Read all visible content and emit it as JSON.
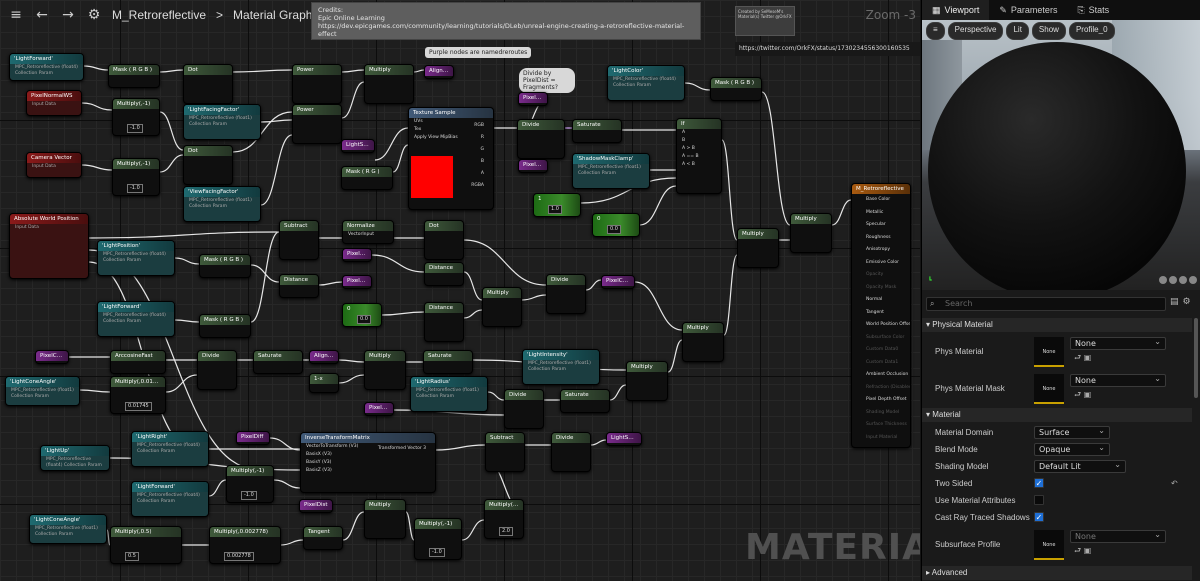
{
  "toolbar": {
    "title": "M_Retroreflective",
    "sep": ">",
    "sub": "Material Graph",
    "zoom": "Zoom -3"
  },
  "comment": {
    "text": "Credits:\nEpic Online Learning\nhttps://dev.epicgames.com/community/learning/tutorials/DLeb/unreal-engine-creating-a-retroreflective-material-effect"
  },
  "notes": {
    "purple": "Purple nodes are namedreroutes",
    "divide_q": "Divide by PixelDist = Fragments?"
  },
  "credit_box": "Created by SeMeseM's Material(s) Twitter @OrkFX",
  "twitter": "https://twitter.com/OrkFX/status/1730234556300160535",
  "watermark": "MATERIAL",
  "nodes": {
    "lightForward1": {
      "title": "'LightForward'",
      "sub": "MPC_Retroreflective (float4) Collection Param"
    },
    "pixelNormal": {
      "title": "PixelNormalWS",
      "sub": "Input Data"
    },
    "cameraVector": {
      "title": "Camera Vector",
      "sub": "Input Data"
    },
    "absWorldPos": {
      "title": "Absolute World Position",
      "sub": "Input Data"
    },
    "maskRGB1": {
      "title": "Mask ( R G B )"
    },
    "mult1": {
      "title": "Multiply(,-1)",
      "val": "-1.0"
    },
    "mult2": {
      "title": "Multiply(,-1)",
      "val": "-1.0"
    },
    "dot1": {
      "title": "Dot"
    },
    "dot2": {
      "title": "Dot"
    },
    "lfFactor": {
      "title": "'LightFacingFactor'",
      "sub": "MPC_Retroreflective (float1) Collection Param"
    },
    "vfFactor": {
      "title": "'ViewFacingFactor'",
      "sub": "MPC_Retroreflective (float1) Collection Param"
    },
    "power1": {
      "title": "Power"
    },
    "power2": {
      "title": "Power"
    },
    "multiplyA": {
      "title": "Multiply"
    },
    "alignDir1": {
      "title": "AlignDir"
    },
    "lightSpace": {
      "title": "LightSpace"
    },
    "maskRG": {
      "title": "Mask ( R G )"
    },
    "texSample": {
      "title": "Texture Sample",
      "pins": [
        "UVs",
        "Tex",
        "Apply View MipBias"
      ],
      "outs": [
        "RGB",
        "R",
        "G",
        "B",
        "A",
        "RGBA"
      ]
    },
    "pixelDist1": {
      "title": "PixelDist"
    },
    "divide1": {
      "title": "Divide"
    },
    "saturate1": {
      "title": "Saturate"
    },
    "pixelDiff1": {
      "title": "PixelDiff"
    },
    "shadowMask": {
      "title": "'ShadowMaskClamp'",
      "sub": "MPC_Retroreflective (float1) Collection Param"
    },
    "lightColor": {
      "title": "'LightColor'",
      "sub": "MPC_Retroreflective (float4) Collection Param"
    },
    "maskRGB2": {
      "title": "Mask ( R G B )"
    },
    "ifNode": {
      "title": "If",
      "pins": [
        "A",
        "B",
        "A > B",
        "A == B",
        "A < B"
      ]
    },
    "const1": {
      "title": "1",
      "val": "1.0"
    },
    "const0": {
      "title": "0",
      "val": "0.0"
    },
    "multRight1": {
      "title": "Multiply"
    },
    "multRight2": {
      "title": "Multiply"
    },
    "multRight3": {
      "title": "Multiply"
    },
    "mResult": {
      "title": "M_Retroreflective",
      "pins": [
        "Base Color",
        "Metallic",
        "Specular",
        "Roughness",
        "Anisotropy",
        "Emissive Color",
        "Opacity",
        "Opacity Mask",
        "Normal",
        "Tangent",
        "World Position Offset",
        "Subsurface Color",
        "Custom Data0",
        "Custom Data1",
        "Ambient Occlusion",
        "Refraction (Disabled)",
        "Pixel Depth Offset",
        "Shading Model",
        "Surface Thickness",
        "Input Material"
      ]
    },
    "subtract1": {
      "title": "Subtract"
    },
    "normalize": {
      "title": "Normalize",
      "pin": "VectorInput"
    },
    "lightPosition": {
      "title": "'LightPosition'",
      "sub": "MPC_Retroreflective (float4) Collection Param"
    },
    "maskRGB3": {
      "title": "Mask ( R G B )"
    },
    "distance1": {
      "title": "Distance"
    },
    "pixelDiff2": {
      "title": "PixelDiff"
    },
    "pixelDist2": {
      "title": "PixelDist"
    },
    "dot3": {
      "title": "Dot"
    },
    "distance2": {
      "title": "Distance"
    },
    "distance3": {
      "title": "Distance"
    },
    "const0b": {
      "title": "0",
      "val": "0.0"
    },
    "multC": {
      "title": "Multiply"
    },
    "divide2": {
      "title": "Divide"
    },
    "pixelCone1": {
      "title": "PixelCone"
    },
    "lightForward2": {
      "title": "'LightForward'",
      "sub": "MPC_Retroreflective (float4) Collection Param"
    },
    "maskRGB4": {
      "title": "Mask ( R G B )"
    },
    "pixelCone2": {
      "title": "PixelCone"
    },
    "lightConeAngle1": {
      "title": "'LightConeAngle'",
      "sub": "MPC_Retroreflective (float1) Collection Param"
    },
    "arccos": {
      "title": "ArccosineFast"
    },
    "mult01745": {
      "title": "Multiply(,0.01745)",
      "val": "0.01745"
    },
    "divide3": {
      "title": "Divide"
    },
    "saturate2": {
      "title": "Saturate"
    },
    "alignDir2": {
      "title": "AlignDir"
    },
    "oneMinus": {
      "title": "1-x"
    },
    "multD": {
      "title": "Multiply"
    },
    "saturate3": {
      "title": "Saturate"
    },
    "lightIntensity": {
      "title": "'LightIntensity'",
      "sub": "MPC_Retroreflective (float1) Collection Param"
    },
    "lightRadius": {
      "title": "'LightRadius'",
      "sub": "MPC_Retroreflective (float1) Collection Param"
    },
    "pixelDist3": {
      "title": "PixelDist"
    },
    "divide4": {
      "title": "Divide"
    },
    "saturate4": {
      "title": "Saturate"
    },
    "multE": {
      "title": "Multiply"
    },
    "multF": {
      "title": "Multiply"
    },
    "lightUp": {
      "title": "'LightUp'",
      "sub": "MPC_Retroreflective (float4) Collection Param"
    },
    "lightRight": {
      "title": "'LightRight'",
      "sub": "MPC_Retroreflective (float4) Collection Param"
    },
    "lightForward3": {
      "title": "'LightForward'",
      "sub": "MPC_Retroreflective (float4) Collection Param"
    },
    "pixelDiff3": {
      "title": "PixelDiff"
    },
    "inverseTM": {
      "title": "InverseTransformMatrix",
      "pins": [
        "VectorToTransform (V3)",
        "BasisX (V3)",
        "BasisY (V3)",
        "BasisZ (V3)"
      ],
      "out": "Transformed Vector 3"
    },
    "multNeg1": {
      "title": "Multiply(,-1)",
      "val": "-1.0"
    },
    "subtract2": {
      "title": "Subtract"
    },
    "divide5": {
      "title": "Divide"
    },
    "lightSpace2": {
      "title": "LightSpace"
    },
    "lightConeAngle2": {
      "title": "'LightConeAngle'",
      "sub": "MPC_Retroreflective (float1) Collection Param"
    },
    "mult05": {
      "title": "Multiply(,0.5)",
      "val": "0.5"
    },
    "mult002778": {
      "title": "Multiply(,0.002778)",
      "val": "0.002778"
    },
    "tangent": {
      "title": "Tangent"
    },
    "pixelDist4": {
      "title": "PixelDist"
    },
    "multG": {
      "title": "Multiply"
    },
    "multNeg2": {
      "title": "Multiply(,-1)",
      "val": "-1.0"
    },
    "mult2b": {
      "title": "Multiply(,2)",
      "val": "2.0"
    }
  },
  "panel": {
    "tabs": [
      "Viewport",
      "Parameters",
      "Stats"
    ],
    "vp_tools": [
      "Perspective",
      "Lit",
      "Show",
      "Profile_0"
    ],
    "search_placeholder": "Search",
    "physical": {
      "section": "Physical Material",
      "phys_label": "Phys Material",
      "phys_value": "None",
      "thumb": "None",
      "mask_label": "Phys Material Mask",
      "mask_value": "None"
    },
    "material": {
      "section": "Material",
      "domain_label": "Material Domain",
      "domain": "Surface",
      "blend_label": "Blend Mode",
      "blend": "Opaque",
      "shading_label": "Shading Model",
      "shading": "Default Lit",
      "twosided_label": "Two Sided",
      "attrs_label": "Use Material Attributes",
      "raytrace_label": "Cast Ray Traced Shadows",
      "subsurf_label": "Subsurface Profile",
      "subsurf_value": "None",
      "thumb": "None"
    },
    "advanced": "Advanced"
  }
}
